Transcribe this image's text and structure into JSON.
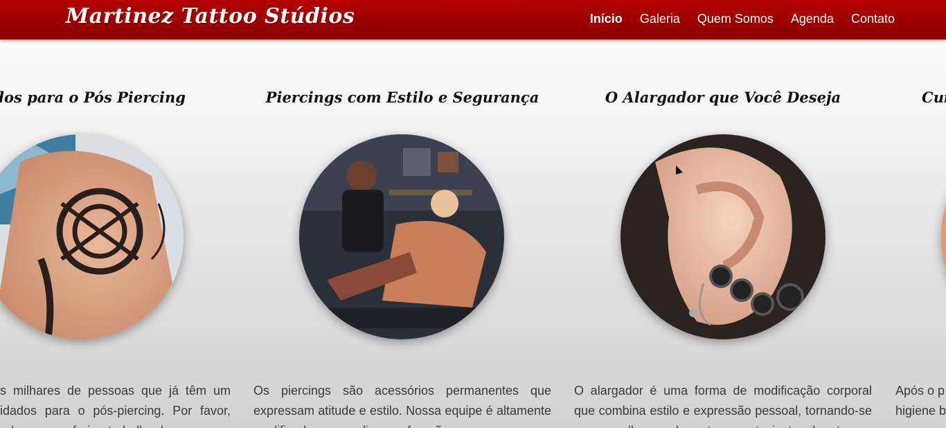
{
  "header": {
    "brand": "Martinez Tattoo Stúdios",
    "nav": [
      {
        "label": "Início",
        "active": true
      },
      {
        "label": "Galeria",
        "active": false
      },
      {
        "label": "Quem Somos",
        "active": false
      },
      {
        "label": "Agenda",
        "active": false
      },
      {
        "label": "Contato",
        "active": false
      }
    ],
    "colors": {
      "bar": "#a00000",
      "text": "#ffffff"
    }
  },
  "cards": [
    {
      "title": "idados para o Pós Piercing",
      "image": "tattooed-chest-photo",
      "text": "s milhares de pessoas que já têm um idados para o pós-piercing. Por favor, ado para conferir o trabalho dos nossos"
    },
    {
      "title": "Piercings com Estilo e Segurança",
      "image": "piercing-studio-photo",
      "text": "Os piercings são acessórios permanentes que expressam atitude e estilo. Nossa equipe é altamente qualificada para realizar perfurações com"
    },
    {
      "title": "O Alargador que Você Deseja",
      "image": "ear-gauges-photo",
      "text": "O alargador é uma forma de modificação corporal que combina estilo e expressão pessoal, tornando-se uma escolha popular entre os entusiastas da arte"
    },
    {
      "title": "Cui",
      "image": "partial-photo",
      "text": "Após o p higiene b enxagu"
    }
  ]
}
